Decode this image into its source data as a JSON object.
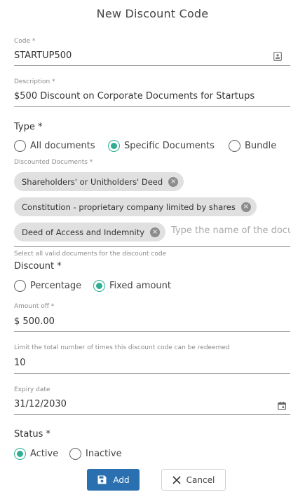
{
  "dialog": {
    "title": "New Discount Code"
  },
  "code": {
    "label": "Code *",
    "value": "STARTUP500",
    "icon": "id-card-icon"
  },
  "description": {
    "label": "Description *",
    "value": "$500 Discount on Corporate Documents for Startups"
  },
  "type": {
    "label": "Type *",
    "options": [
      "All documents",
      "Specific Documents",
      "Bundle"
    ],
    "selected": "Specific Documents"
  },
  "documents": {
    "label": "Discounted Documents *",
    "chips": [
      "Shareholders' or Unitholders' Deed",
      "Constitution - proprietary company limited by shares",
      "Deed of Access and Indemnity"
    ],
    "placeholder": "Type the name of the document",
    "helper": "Select all valid documents for the discount code"
  },
  "discount": {
    "label": "Discount *",
    "options": [
      "Percentage",
      "Fixed amount"
    ],
    "selected": "Fixed amount"
  },
  "amount": {
    "label": "Amount off *",
    "prefix": "$",
    "value": "500.00"
  },
  "limit": {
    "label": "Limit the total number of times this discount code can be redeemed",
    "value": "10"
  },
  "expiry": {
    "label": "Expiry date",
    "value": "31/12/2030",
    "icon": "calendar-icon"
  },
  "status": {
    "label": "Status *",
    "options": [
      "Active",
      "Inactive"
    ],
    "selected": "Active"
  },
  "buttons": {
    "add": "Add",
    "cancel": "Cancel"
  },
  "colors": {
    "accent": "#2fae92",
    "primary": "#2a6fb0"
  }
}
